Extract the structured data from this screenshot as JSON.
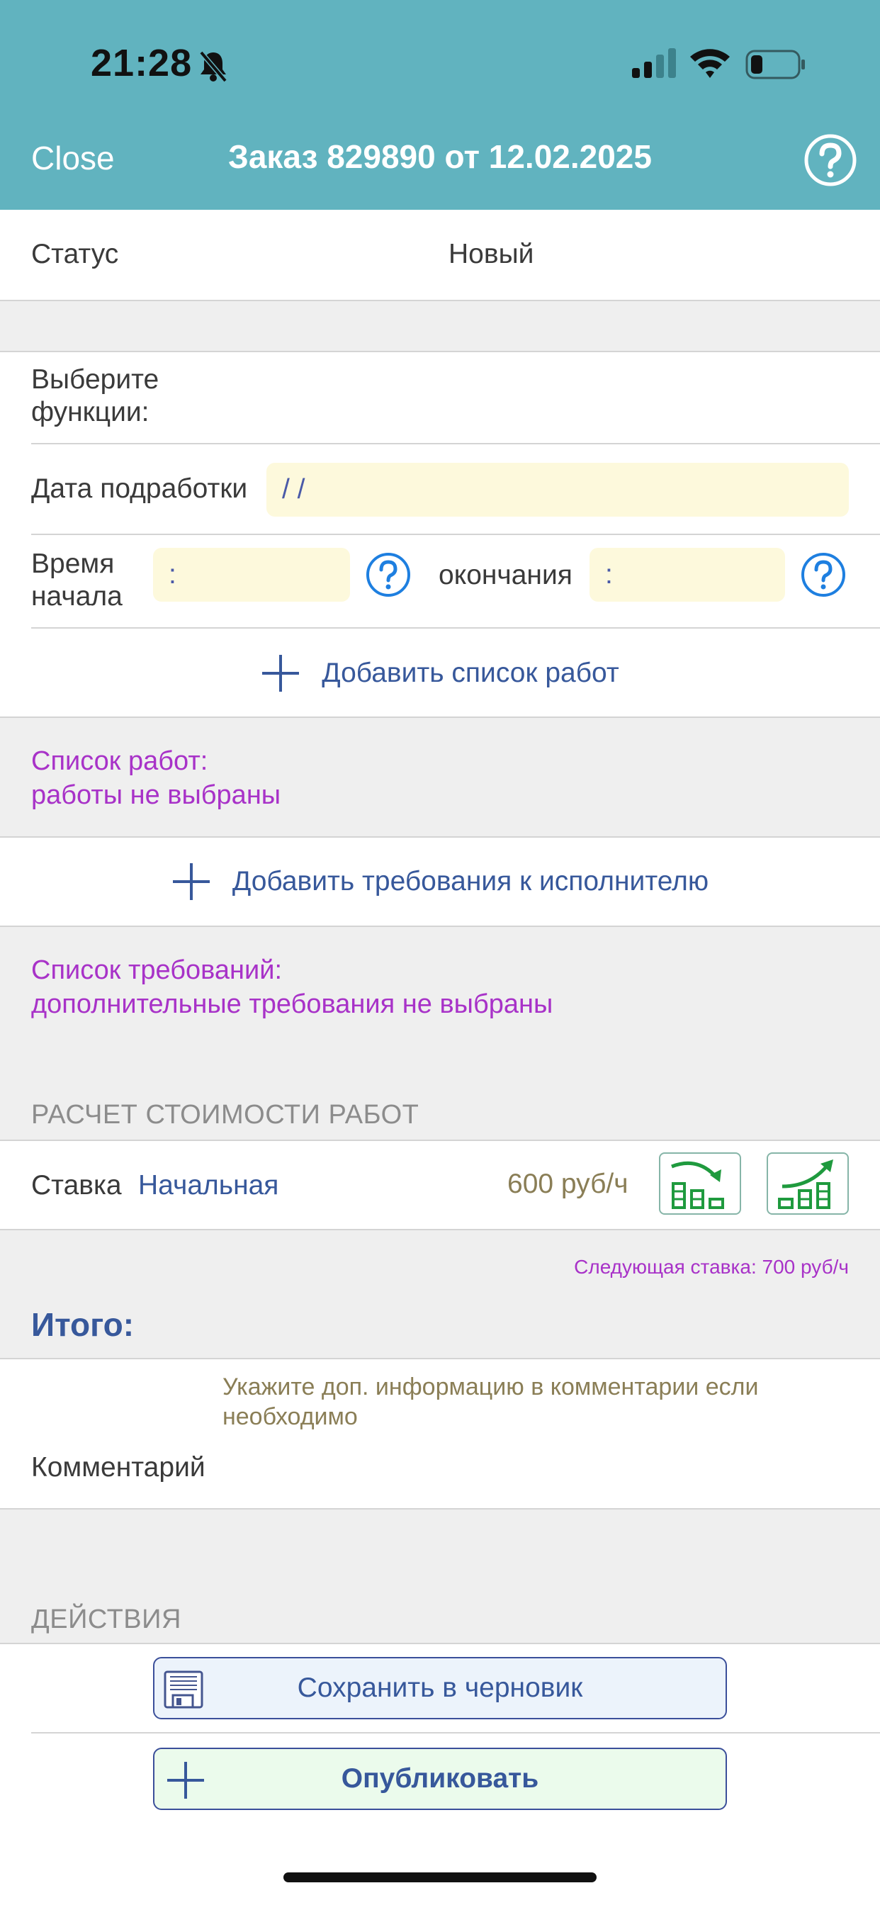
{
  "status_bar": {
    "time": "21:28"
  },
  "nav": {
    "close": "Close",
    "title": "Заказ 829890 от 12.02.2025"
  },
  "status": {
    "label": "Статус",
    "value": "Новый"
  },
  "functions": {
    "label_line1": "Выберите",
    "label_line2": "функции:"
  },
  "date": {
    "label": "Дата подработки",
    "value": " /  /"
  },
  "time": {
    "start_label_line1": "Время",
    "start_label_line2": "начала",
    "start_value": ":",
    "end_label": "окончания",
    "end_value": ":"
  },
  "works": {
    "add_label": "Добавить список работ",
    "list_title": "Список работ:",
    "list_value": "работы не выбраны"
  },
  "requirements": {
    "add_label": "Добавить требования к исполнителю",
    "list_title": "Список требований:",
    "list_value": "дополнительные требования не выбраны"
  },
  "cost": {
    "caption": "РАСЧЕТ СТОИМОСТИ РАБОТ",
    "rate_label": "Ставка",
    "rate_name": "Начальная",
    "rate_value": "600 руб/ч",
    "next_rate": "Следующая ставка: 700 руб/ч",
    "total_label": "Итого:"
  },
  "comment": {
    "hint_line1": "Укажите доп. информацию в комментарии если",
    "hint_line2": "необходимо",
    "label": "Комментарий"
  },
  "actions": {
    "caption": "ДЕЙСТВИЯ",
    "save_draft": "Сохранить в черновик",
    "publish": "Опубликовать"
  },
  "colors": {
    "header": "#61b3bf",
    "accent_blue": "#37589b",
    "purple": "#a832c8",
    "input_bg": "#fdf9dc",
    "rate_green": "#1f9a3e",
    "save_bg": "#ecf3fb",
    "publish_bg": "#ebfbec"
  }
}
